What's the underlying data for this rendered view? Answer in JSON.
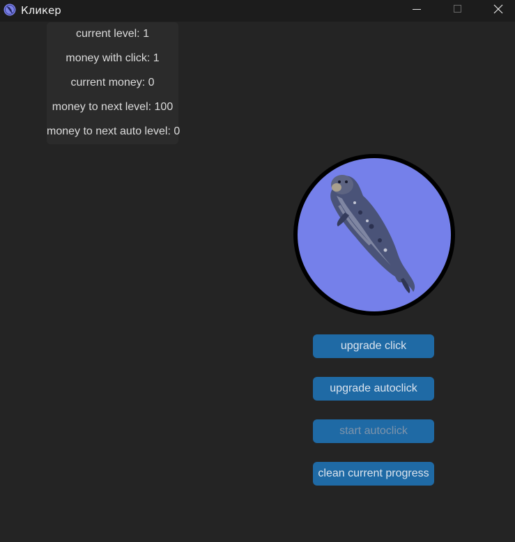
{
  "window": {
    "title": "Кликер",
    "icons": {
      "app": "app-logo-icon",
      "minimize": "minimize-icon",
      "maximize": "maximize-icon",
      "close": "close-icon"
    }
  },
  "stats": {
    "current_level": "current level: 1",
    "money_with_click": "money with click: 1",
    "current_money": "current money: 0",
    "money_to_next_level": "money to next level: 100",
    "money_to_next_auto_level": "money to next auto level: 0"
  },
  "clicker": {
    "image": "seal-image",
    "background_color": "#7580ea"
  },
  "buttons": {
    "upgrade_click": "upgrade click",
    "upgrade_autoclick": "upgrade autoclick",
    "start_autoclick": "start autoclick",
    "clean_progress": "clean current progress"
  },
  "colors": {
    "button": "#1f6aa5",
    "background": "#242424",
    "panel": "#2b2b2b"
  }
}
